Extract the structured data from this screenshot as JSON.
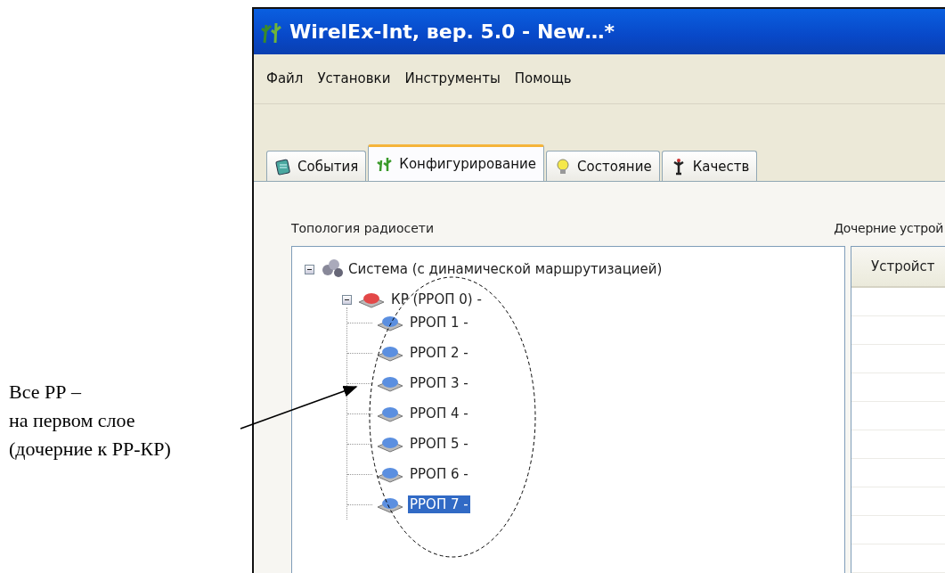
{
  "annotation": {
    "text": "Все РР –\nна первом слое\n(дочерние к РР-КР)"
  },
  "window": {
    "title": "WirelEx-Int, вер. 5.0 - New…*"
  },
  "menu": [
    "Файл",
    "Установки",
    "Инструменты",
    "Помощь"
  ],
  "tabs": [
    {
      "label": "События",
      "kind": "events",
      "selected": false
    },
    {
      "label": "Конфигурирование",
      "kind": "config",
      "selected": true
    },
    {
      "label": "Состояние",
      "kind": "state",
      "selected": false
    },
    {
      "label": "Качеств",
      "kind": "quality",
      "selected": false
    }
  ],
  "topology": {
    "label": "Топология радиосети",
    "tree": [
      {
        "label": "Система (с динамической маршрутизацией)",
        "kind": "system",
        "expanded": true,
        "selected": false,
        "children": [
          {
            "label": "КР (РРОП 0) -",
            "kind": "coordinator",
            "expanded": true,
            "selected": false,
            "children": [
              {
                "label": "РРОП 1 -",
                "kind": "router",
                "selected": false
              },
              {
                "label": "РРОП 2 -",
                "kind": "router",
                "selected": false
              },
              {
                "label": "РРОП 3 -",
                "kind": "router",
                "selected": false
              },
              {
                "label": "РРОП 4 -",
                "kind": "router",
                "selected": false
              },
              {
                "label": "РРОП 5 -",
                "kind": "router",
                "selected": false
              },
              {
                "label": "РРОП 6 -",
                "kind": "router",
                "selected": false
              },
              {
                "label": "РРОП 7 -",
                "kind": "router",
                "selected": true
              }
            ]
          }
        ]
      }
    ]
  },
  "children_panel": {
    "label": "Дочерние устрой",
    "columns": [
      "Устройст"
    ]
  }
}
